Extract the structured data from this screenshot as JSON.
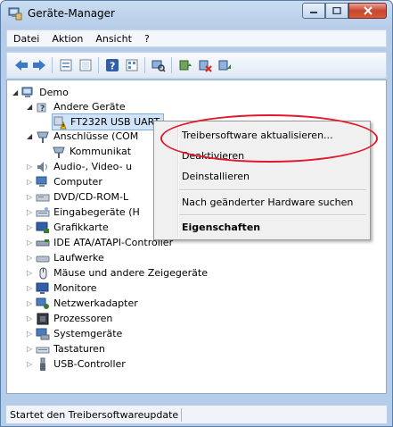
{
  "window": {
    "title": "Geräte-Manager",
    "title_icon": "device-manager-icon",
    "colors": {
      "frame": "#b6cde9",
      "close": "#c7462d",
      "selection": "#cfe4fa",
      "highlight_ring": "#e11a2c"
    }
  },
  "menu": [
    "Datei",
    "Aktion",
    "Ansicht",
    "?"
  ],
  "toolbar": [
    "back-arrow-icon",
    "forward-arrow-icon",
    "properties-icon",
    "update-driver-icon",
    "help-icon",
    "view-icon",
    "scan-hardware-icon",
    "enable-device-icon",
    "uninstall-icon",
    "disable-device-icon"
  ],
  "tree": {
    "root": "Demo",
    "items": [
      {
        "label": "Andere Geräte",
        "icon": "unknown-device-icon"
      },
      {
        "label": "FT232R USB UART",
        "icon": "warning-device-icon"
      },
      {
        "label": "Anschlüsse (COM",
        "icon": "port-icon"
      },
      {
        "label": "Kommunikat",
        "icon": "port-icon"
      },
      {
        "label": "Audio-, Video- u",
        "icon": "speaker-icon"
      },
      {
        "label": "Computer",
        "icon": "computer-icon"
      },
      {
        "label": "DVD/CD-ROM-L",
        "icon": "dvd-drive-icon"
      },
      {
        "label": "Eingabegeräte (H",
        "icon": "keyboard-icon"
      },
      {
        "label": "Grafikkarte",
        "icon": "display-adapter-icon"
      },
      {
        "label": "IDE ATA/ATAPI-Controller",
        "icon": "ide-controller-icon"
      },
      {
        "label": "Laufwerke",
        "icon": "disk-drive-icon"
      },
      {
        "label": "Mäuse und andere Zeigegeräte",
        "icon": "mouse-icon"
      },
      {
        "label": "Monitore",
        "icon": "monitor-icon"
      },
      {
        "label": "Netzwerkadapter",
        "icon": "network-adapter-icon"
      },
      {
        "label": "Prozessoren",
        "icon": "processor-icon"
      },
      {
        "label": "Systemgeräte",
        "icon": "system-device-icon"
      },
      {
        "label": "Tastaturen",
        "icon": "keyboard-icon"
      },
      {
        "label": "USB-Controller",
        "icon": "usb-icon"
      }
    ]
  },
  "context_menu": {
    "update": "Treibersoftware aktualisieren...",
    "disable": "Deaktivieren",
    "uninstall": "Deinstallieren",
    "scan": "Nach geänderter Hardware suchen",
    "properties": "Eigenschaften"
  },
  "status": "Startet den Treibersoftwareupdate"
}
